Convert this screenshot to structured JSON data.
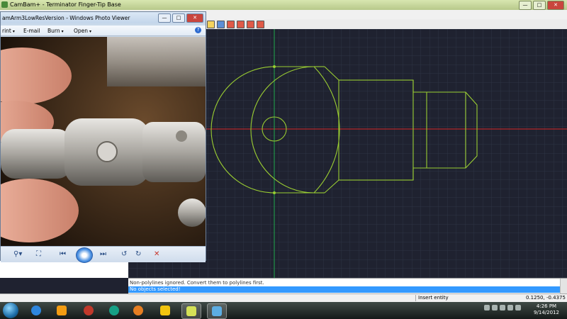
{
  "cambam": {
    "title": "CamBam+ - Terminator Finger-Tip Base",
    "message_line1": "Non-polylines ignored.  Convert them to polylines first.",
    "message_line2": "No objects selected!",
    "status_mode": "Insert entity",
    "status_coords": "0.1250, -0.4375",
    "grid_color": "#2e3444",
    "shape_color": "#9acd32",
    "x_axis_color": "#d42424",
    "y_axis_color": "#1fa84b"
  },
  "photo_viewer": {
    "title": "amArm3LowResVersion - Windows Photo Viewer",
    "menu": [
      "rint",
      "E-mail",
      "Burn",
      "Open"
    ],
    "help": "?"
  },
  "taskbar": {
    "time": "4:26 PM",
    "date": "9/14/2012",
    "apps": [
      "internet-explorer",
      "media-player",
      "chrome-like",
      "firefox",
      "file-explorer",
      "cambam",
      "photo-viewer"
    ]
  },
  "icons": {
    "minimize": "—",
    "maximize": "□",
    "close": "✕"
  }
}
